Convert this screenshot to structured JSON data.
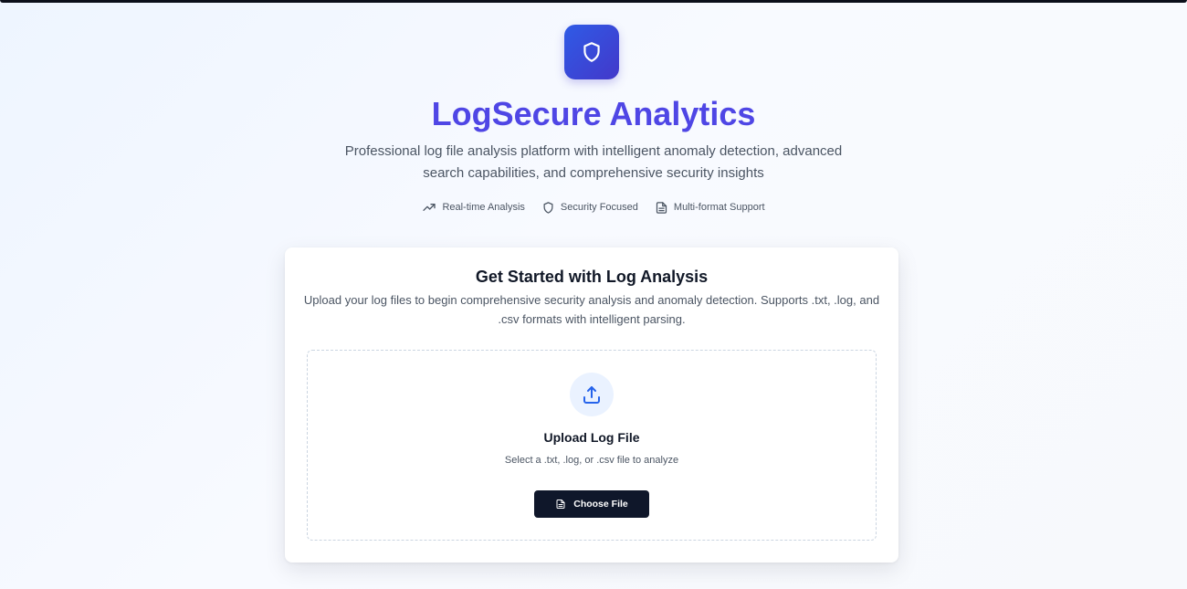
{
  "header": {
    "logo_icon": "shield-icon",
    "title": "LogSecure Analytics",
    "subtitle": "Professional log file analysis platform with intelligent anomaly detection, advanced search capabilities, and comprehensive security insights",
    "features": [
      {
        "icon": "trending-up-icon",
        "label": "Real-time Analysis"
      },
      {
        "icon": "shield-icon",
        "label": "Security Focused"
      },
      {
        "icon": "file-text-icon",
        "label": "Multi-format Support"
      }
    ]
  },
  "card": {
    "title": "Get Started with Log Analysis",
    "description": "Upload your log files to begin comprehensive security analysis and anomaly detection. Supports .txt, .log, and .csv formats with intelligent parsing.",
    "dropzone": {
      "icon": "upload-icon",
      "title": "Upload Log File",
      "hint": "Select a .txt, .log, or .csv file to analyze",
      "button_icon": "file-text-icon",
      "button_label": "Choose File"
    }
  },
  "colors": {
    "accent": "#4f46e5",
    "logo_gradient_start": "#2f5be6",
    "logo_gradient_end": "#4338ca",
    "button_bg": "#0f172a",
    "upload_icon": "#2563eb"
  }
}
